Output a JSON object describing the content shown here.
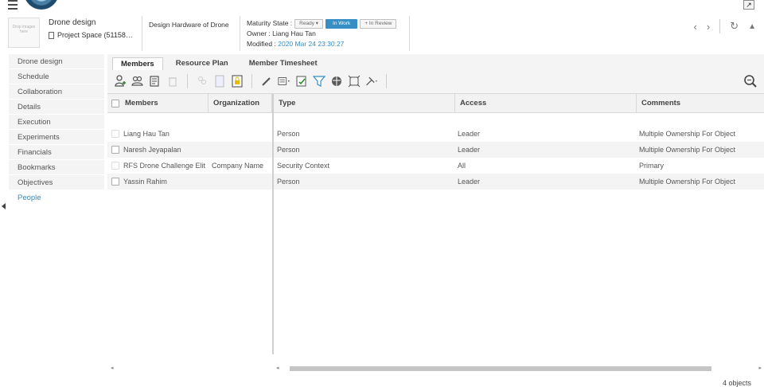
{
  "header": {
    "thumbnail_text": "Drop images here",
    "title": "Drone design",
    "space": "Project Space (51158…",
    "description": "Design Hardware of Drone",
    "maturity_label": "Maturity State :",
    "states": [
      {
        "label": "Ready ▾",
        "active": false
      },
      {
        "label": "In Work",
        "active": true
      },
      {
        "label": "+ In Review",
        "active": false
      }
    ],
    "owner_label": "Owner :",
    "owner": "Liang Hau Tan",
    "modified_label": "Modified :",
    "modified_date": "2020 Mar 24 23:30:27"
  },
  "nav": {
    "prev": "‹",
    "next": "›",
    "refresh": "↻",
    "collapse": "▲"
  },
  "sidebar": {
    "items": [
      {
        "label": "Drone design"
      },
      {
        "label": "Schedule"
      },
      {
        "label": "Collaboration"
      },
      {
        "label": "Details"
      },
      {
        "label": "Execution"
      },
      {
        "label": "Experiments"
      },
      {
        "label": "Financials"
      },
      {
        "label": "Bookmarks"
      },
      {
        "label": "Objectives"
      },
      {
        "label": "People"
      }
    ],
    "active": "People"
  },
  "tabs": [
    {
      "label": "Members",
      "active": true
    },
    {
      "label": "Resource Plan",
      "active": false
    },
    {
      "label": "Member Timesheet",
      "active": false
    }
  ],
  "grid": {
    "columns": [
      "Members",
      "Organization",
      "Type",
      "Access",
      "Comments"
    ],
    "rows": [
      {
        "member": "Liang Hau Tan",
        "organization": "",
        "type": "Person",
        "access": "Leader",
        "comments": "Multiple Ownership For Object",
        "selectable": false
      },
      {
        "member": "Naresh Jeyapalan",
        "organization": "",
        "type": "Person",
        "access": "Leader",
        "comments": "Multiple Ownership For Object",
        "selectable": true
      },
      {
        "member": "RFS Drone Challenge Elit",
        "organization": "Company Name",
        "type": "Security Context",
        "access": "All",
        "comments": "Primary",
        "selectable": false
      },
      {
        "member": "Yassin Rahim",
        "organization": "",
        "type": "Person",
        "access": "Leader",
        "comments": "Multiple Ownership For Object",
        "selectable": true
      }
    ],
    "count_text": "4 objects"
  }
}
